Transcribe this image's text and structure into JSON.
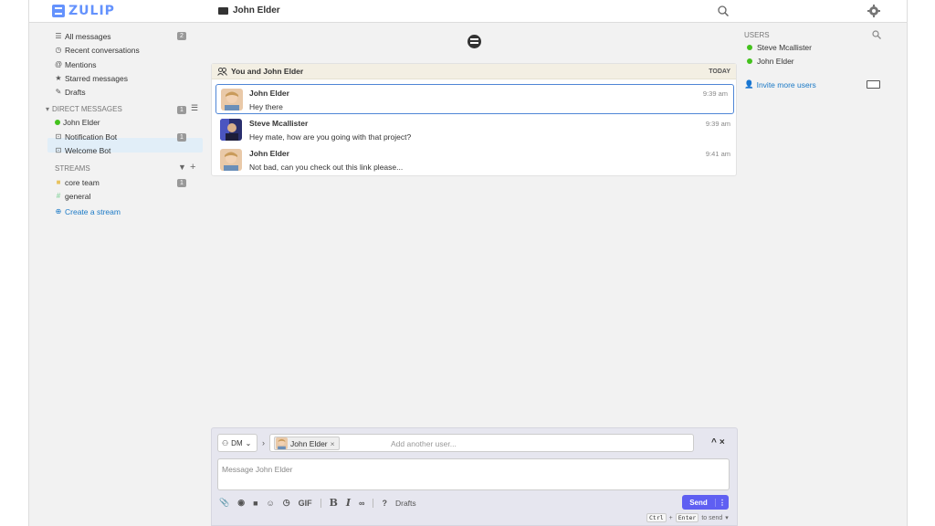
{
  "app": {
    "logo_text": "ZULIP",
    "title": "John Elder",
    "brand_color": "#6492fd"
  },
  "left_sidebar": {
    "views": [
      {
        "label": "All messages",
        "badge": "2",
        "icon": "all-messages-icon"
      },
      {
        "label": "Recent conversations",
        "icon": "clock-icon"
      },
      {
        "label": "Mentions",
        "icon": "at-icon"
      },
      {
        "label": "Starred messages",
        "icon": "star-icon"
      },
      {
        "label": "Drafts",
        "icon": "pencil-icon"
      }
    ],
    "dm_section_label": "DIRECT MESSAGES",
    "dm_section_badge": "1",
    "dms": [
      {
        "label": "John Elder",
        "icon": "online-dot",
        "active": true
      },
      {
        "label": "Notification Bot",
        "badge": "1",
        "icon": "bot-icon"
      },
      {
        "label": "Welcome Bot",
        "icon": "bot-icon"
      }
    ],
    "streams_label": "STREAMS",
    "streams": [
      {
        "label": "core team",
        "badge": "1",
        "icon": "lock-icon",
        "color": "#f5d98a"
      },
      {
        "label": "general",
        "icon": "hash-icon",
        "color": "#76ce90"
      }
    ],
    "create_stream": "Create a stream"
  },
  "message_view": {
    "recipient": "You and John Elder",
    "date": "TODAY",
    "messages": [
      {
        "sender": "John Elder",
        "time": "9:39 am",
        "content": "Hey there",
        "selected": true
      },
      {
        "sender": "Steve Mcallister",
        "time": "9:39 am",
        "content": "Hey mate, how are you going with that project?"
      },
      {
        "sender": "John Elder",
        "time": "9:41 am",
        "content": "Not bad, can you check out this link please..."
      }
    ]
  },
  "right_sidebar": {
    "users_label": "USERS",
    "users": [
      {
        "name": "Steve Mcallister",
        "status_color": "#44c21d"
      },
      {
        "name": "John Elder",
        "status_color": "#44c21d"
      }
    ],
    "invite": "Invite more users"
  },
  "compose": {
    "type_label": "DM",
    "recipient_pill": "John Elder",
    "add_user_placeholder": "Add another user...",
    "message_placeholder": "Message John Elder",
    "gif_label": "GIF",
    "drafts_label": "Drafts",
    "help_label": "?",
    "send_label": "Send",
    "hint_key1": "Ctrl",
    "hint_key2": "Enter",
    "hint_text": "to send",
    "send_color": "#5f5ff2"
  }
}
